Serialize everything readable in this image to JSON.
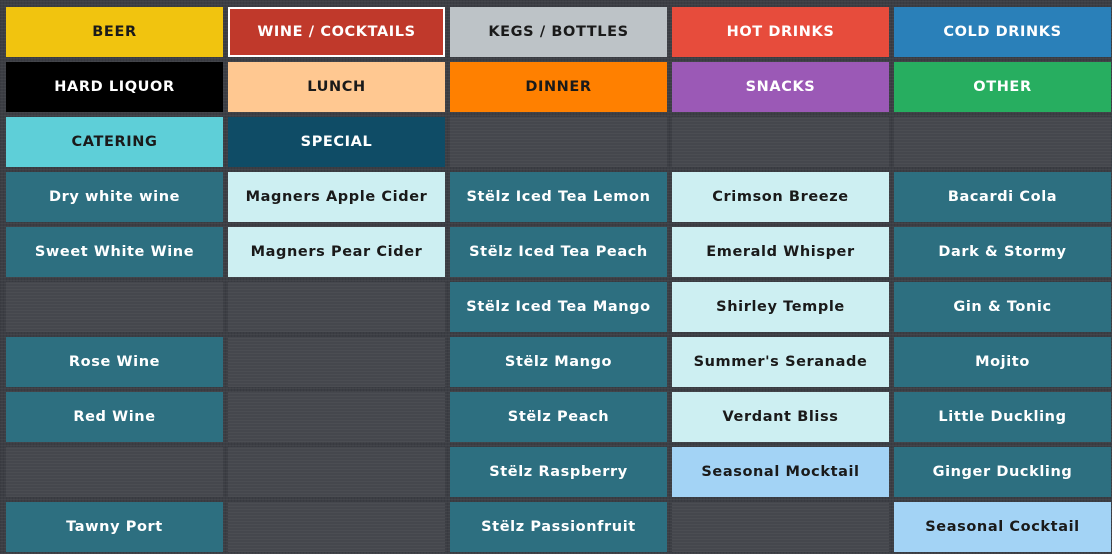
{
  "categories": [
    {
      "label": "BEER",
      "bg": "#f1c40f",
      "fg": "#1a1a1a"
    },
    {
      "label": "WINE / COCKTAILS",
      "bg": "#c0392b",
      "fg": "#ffffff",
      "selected": true
    },
    {
      "label": "KEGS / BOTTLES",
      "bg": "#bdc3c7",
      "fg": "#1a1a1a"
    },
    {
      "label": "HOT DRINKS",
      "bg": "#e74c3c",
      "fg": "#ffffff"
    },
    {
      "label": "COLD DRINKS",
      "bg": "#2a80b9",
      "fg": "#ffffff"
    },
    {
      "label": "HARD LIQUOR",
      "bg": "#000000",
      "fg": "#ffffff"
    },
    {
      "label": "LUNCH",
      "bg": "#ffc891",
      "fg": "#1a1a1a"
    },
    {
      "label": "DINNER",
      "bg": "#ff8000",
      "fg": "#1a1a1a"
    },
    {
      "label": "SNACKS",
      "bg": "#9b59b6",
      "fg": "#ffffff"
    },
    {
      "label": "OTHER",
      "bg": "#27ae60",
      "fg": "#ffffff"
    },
    {
      "label": "CATERING",
      "bg": "#5ecfd8",
      "fg": "#1a1a1a"
    },
    {
      "label": "SPECIAL",
      "bg": "#0f4c66",
      "fg": "#ffffff"
    },
    null,
    null,
    null
  ],
  "items": [
    {
      "label": "Dry white wine",
      "bg": "#2d6f80",
      "fg": "#ffffff"
    },
    {
      "label": "Magners Apple Cider",
      "bg": "#cdeff2",
      "fg": "#1a1a1a"
    },
    {
      "label": "Stëlz Iced Tea Lemon",
      "bg": "#2d6f80",
      "fg": "#ffffff"
    },
    {
      "label": "Crimson Breeze",
      "bg": "#cdeff2",
      "fg": "#1a1a1a"
    },
    {
      "label": "Bacardi Cola",
      "bg": "#2d6f80",
      "fg": "#ffffff"
    },
    {
      "label": "Sweet White Wine",
      "bg": "#2d6f80",
      "fg": "#ffffff"
    },
    {
      "label": "Magners Pear Cider",
      "bg": "#cdeff2",
      "fg": "#1a1a1a"
    },
    {
      "label": "Stëlz Iced Tea Peach",
      "bg": "#2d6f80",
      "fg": "#ffffff"
    },
    {
      "label": "Emerald Whisper",
      "bg": "#cdeff2",
      "fg": "#1a1a1a"
    },
    {
      "label": "Dark & Stormy",
      "bg": "#2d6f80",
      "fg": "#ffffff"
    },
    null,
    null,
    {
      "label": "Stëlz Iced Tea Mango",
      "bg": "#2d6f80",
      "fg": "#ffffff"
    },
    {
      "label": "Shirley Temple",
      "bg": "#cdeff2",
      "fg": "#1a1a1a"
    },
    {
      "label": "Gin & Tonic",
      "bg": "#2d6f80",
      "fg": "#ffffff"
    },
    {
      "label": "Rose Wine",
      "bg": "#2d6f80",
      "fg": "#ffffff"
    },
    null,
    {
      "label": "Stëlz Mango",
      "bg": "#2d6f80",
      "fg": "#ffffff"
    },
    {
      "label": "Summer's Seranade",
      "bg": "#cdeff2",
      "fg": "#1a1a1a"
    },
    {
      "label": "Mojito",
      "bg": "#2d6f80",
      "fg": "#ffffff"
    },
    {
      "label": "Red Wine",
      "bg": "#2d6f80",
      "fg": "#ffffff"
    },
    null,
    {
      "label": "Stëlz Peach",
      "bg": "#2d6f80",
      "fg": "#ffffff"
    },
    {
      "label": "Verdant Bliss",
      "bg": "#cdeff2",
      "fg": "#1a1a1a"
    },
    {
      "label": "Little Duckling",
      "bg": "#2d6f80",
      "fg": "#ffffff"
    },
    null,
    null,
    {
      "label": "Stëlz Raspberry",
      "bg": "#2d6f80",
      "fg": "#ffffff"
    },
    {
      "label": "Seasonal Mocktail",
      "bg": "#a3d3f5",
      "fg": "#1a1a1a"
    },
    {
      "label": "Ginger Duckling",
      "bg": "#2d6f80",
      "fg": "#ffffff"
    },
    {
      "label": "Tawny Port",
      "bg": "#2d6f80",
      "fg": "#ffffff"
    },
    null,
    {
      "label": "Stëlz Passionfruit",
      "bg": "#2d6f80",
      "fg": "#ffffff"
    },
    null,
    {
      "label": "Seasonal Cocktail",
      "bg": "#a3d3f5",
      "fg": "#1a1a1a"
    }
  ]
}
